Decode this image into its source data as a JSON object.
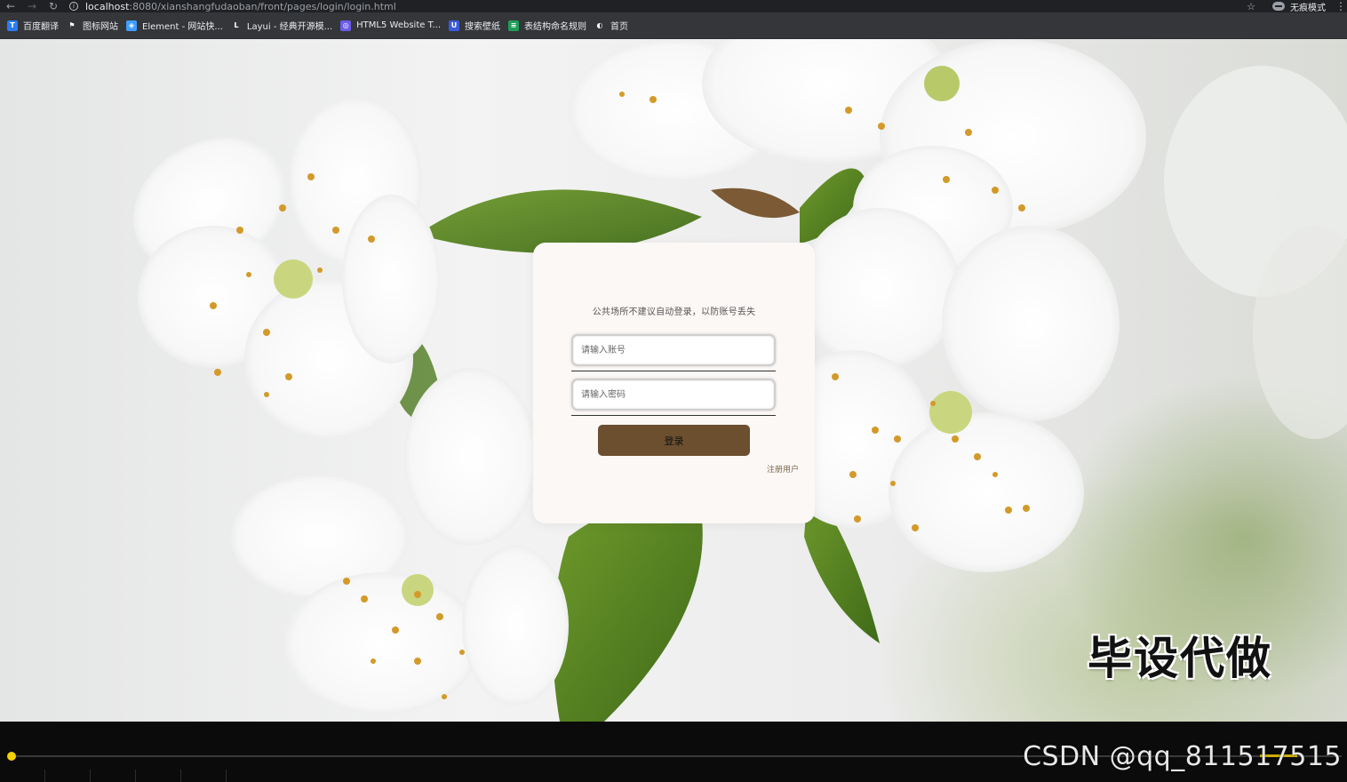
{
  "browser": {
    "url_host": "localhost",
    "url_path": ":8080/xianshangfudaoban/front/pages/login/login.html",
    "incognito_label": "无痕模式",
    "bookmarks": [
      {
        "label": "百度翻译",
        "icon": "translate-icon",
        "color": "#2b7bf3",
        "glyph": "T"
      },
      {
        "label": "图标网站",
        "icon": "flag-icon",
        "color": "#35363a",
        "glyph": "⚑"
      },
      {
        "label": "Element - 网站快...",
        "icon": "element-icon",
        "color": "#409eff",
        "glyph": "◈"
      },
      {
        "label": "Layui - 经典开源模...",
        "icon": "layui-icon",
        "color": "#35363a",
        "glyph": "L"
      },
      {
        "label": "HTML5 Website T...",
        "icon": "html5-icon",
        "color": "#6c5ce7",
        "glyph": "◎"
      },
      {
        "label": "搜索壁纸",
        "icon": "wallpaper-icon",
        "color": "#3b5bdb",
        "glyph": "U"
      },
      {
        "label": "表结构命名规则",
        "icon": "table-icon",
        "color": "#1e9e5a",
        "glyph": "≡"
      },
      {
        "label": "首页",
        "icon": "globe-icon",
        "color": "#35363a",
        "glyph": "◐"
      }
    ]
  },
  "login": {
    "notice": "公共场所不建议自动登录，以防账号丢失",
    "username_placeholder": "请输入账号",
    "password_placeholder": "请输入密码",
    "login_button": "登录",
    "register_link": "注册用户"
  },
  "watermark": "毕设代做",
  "player": {
    "csdn_label": "CSDN @qq_811517515"
  },
  "colors": {
    "login_button": "#6b4f2e",
    "card_bg": "#fbf8f6",
    "progress_accent": "#f4d000"
  }
}
